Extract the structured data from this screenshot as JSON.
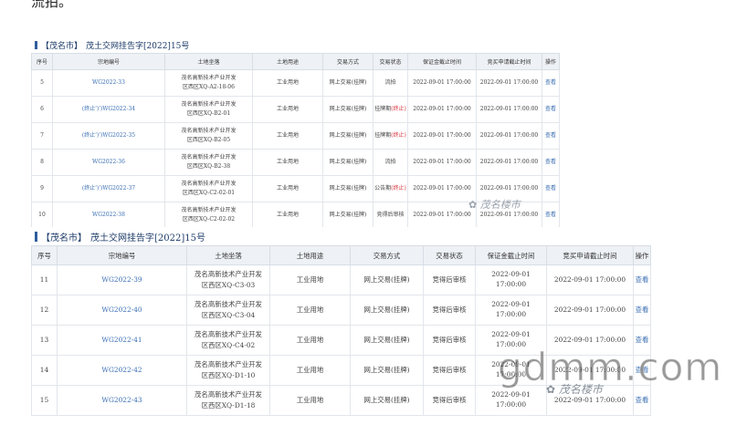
{
  "top_text": "流拍。",
  "panel1": {
    "city": "【茂名市】",
    "title": "茂土交网挂告字[2022]15号",
    "columns": [
      "序号",
      "宗地编号",
      "土地坐落",
      "土地用途",
      "交易方式",
      "交易状态",
      "保证金截止时间",
      "竞买申请截止时间",
      "操作"
    ],
    "rows": [
      {
        "no": "5",
        "code": "WG2022-33",
        "loc1": "茂名高新技术产业开发",
        "loc2": "区西区XQ-A2-18-06",
        "use": "工业用地",
        "method": "网上交易(挂牌)",
        "status": "流拍",
        "status_note": "",
        "deposit": "2022-09-01 17:00:00",
        "apply": "2022-09-01 17:00:00",
        "op": "查看"
      },
      {
        "no": "6",
        "code": "(终止')')WG2022-34",
        "loc1": "茂名高新技术产业开发",
        "loc2": "区西区XQ-B2-01",
        "use": "工业用地",
        "method": "网上交易(挂牌)",
        "status": "挂牌期",
        "status_note": "(终止)",
        "deposit": "2022-09-01 17:00:00",
        "apply": "2022-09-01 17:00:00",
        "op": "查看"
      },
      {
        "no": "7",
        "code": "(终止')')WG2022-35",
        "loc1": "茂名高新技术产业开发",
        "loc2": "区西区XQ-B2-05",
        "use": "工业用地",
        "method": "网上交易(挂牌)",
        "status": "挂牌期",
        "status_note": "(终止)",
        "deposit": "2022-09-01 17:00:00",
        "apply": "2022-09-01 17:00:00",
        "op": "查看"
      },
      {
        "no": "8",
        "code": "WG2022-36",
        "loc1": "茂名高新技术产业开发",
        "loc2": "区西区XQ-B2-38",
        "use": "工业用地",
        "method": "网上交易(挂牌)",
        "status": "流拍",
        "status_note": "",
        "deposit": "2022-09-01 17:00:00",
        "apply": "2022-09-01 17:00:00",
        "op": "查看"
      },
      {
        "no": "9",
        "code": "(终止')')WG2022-37",
        "loc1": "茂名高新技术产业开发",
        "loc2": "区西区XQ-C2-02-01",
        "use": "工业用地",
        "method": "网上交易(挂牌)",
        "status": "公告期",
        "status_note": "(终止)",
        "deposit": "2022-09-01 17:00:00",
        "apply": "2022-09-01 17:00:00",
        "op": "查看"
      },
      {
        "no": "10",
        "code": "WG2022-38",
        "loc1": "茂名高新技术产业开发",
        "loc2": "区西区XQ-C2-02-02",
        "use": "工业用地",
        "method": "网上交易(挂牌)",
        "status": "竞得后审核",
        "status_note": "",
        "deposit": "2022-09-01 17:00:00",
        "apply": "2022-09-01 17:00:00",
        "op": "查看"
      }
    ]
  },
  "panel2": {
    "city": "【茂名市】",
    "title": "茂土交网挂告字[2022]15号",
    "columns": [
      "序号",
      "宗地编号",
      "土地坐落",
      "土地用途",
      "交易方式",
      "交易状态",
      "保证金截止时间",
      "竞买申请截止时间",
      "操作"
    ],
    "rows": [
      {
        "no": "11",
        "code": "WG2022-39",
        "loc1": "茂名高新技术产业开发",
        "loc2": "区西区XQ-C3-03",
        "use": "工业用地",
        "method": "网上交易(挂牌)",
        "status": "竞得后审核",
        "deposit": "2022-09-01 17:00:00",
        "apply": "2022-09-01 17:00:00",
        "op": "查看"
      },
      {
        "no": "12",
        "code": "WG2022-40",
        "loc1": "茂名高新技术产业开发",
        "loc2": "区西区XQ-C3-04",
        "use": "工业用地",
        "method": "网上交易(挂牌)",
        "status": "竞得后审核",
        "deposit": "2022-09-01 17:00:00",
        "apply": "2022-09-01 17:00:00",
        "op": "查看"
      },
      {
        "no": "13",
        "code": "WG2022-41",
        "loc1": "茂名高新技术产业开发",
        "loc2": "区西区XQ-C4-02",
        "use": "工业用地",
        "method": "网上交易(挂牌)",
        "status": "竞得后审核",
        "deposit": "2022-09-01 17:00:00",
        "apply": "2022-09-01 17:00:00",
        "op": "查看"
      },
      {
        "no": "14",
        "code": "WG2022-42",
        "loc1": "茂名高新技术产业开发",
        "loc2": "区西区XQ-D1-10",
        "use": "工业用地",
        "method": "网上交易(挂牌)",
        "status": "竞得后审核",
        "deposit": "2022-09-01 17:00:00",
        "apply": "2022-09-01 17:00:00",
        "op": "查看"
      },
      {
        "no": "15",
        "code": "WG2022-43",
        "loc1": "茂名高新技术产业开发",
        "loc2": "区西区XQ-D1-18",
        "use": "工业用地",
        "method": "网上交易(挂牌)",
        "status": "竞得后审核",
        "deposit": "2022-09-01 17:00:00",
        "apply": "2022-09-01 17:00:00",
        "op": "查看"
      }
    ]
  },
  "watermarks": {
    "wechat_small": "✿ 茂名楼市",
    "site_logo": "gdmm.com",
    "wechat_bottom": "✿ 茂名楼市"
  }
}
